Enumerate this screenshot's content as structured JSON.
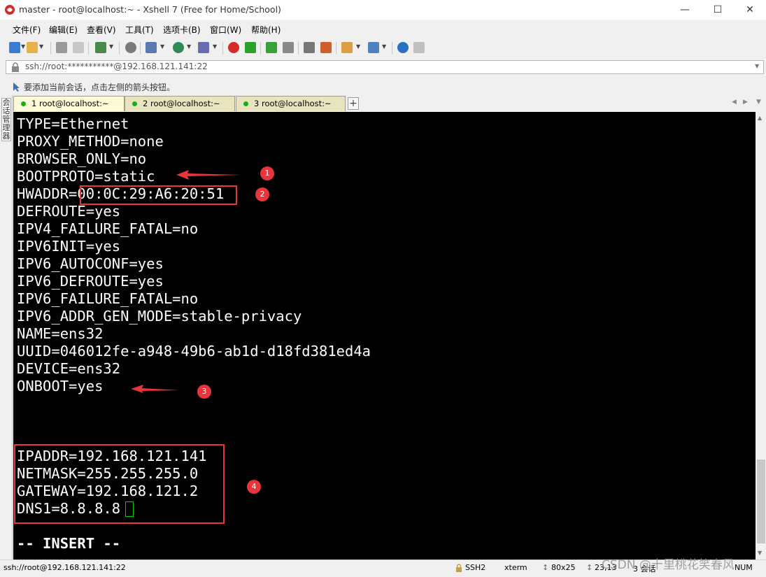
{
  "window": {
    "title": "master - root@localhost:~ - Xshell 7 (Free for Home/School)"
  },
  "menu": [
    "文件(F)",
    "编辑(E)",
    "查看(V)",
    "工具(T)",
    "选项卡(B)",
    "窗口(W)",
    "帮助(H)"
  ],
  "address": "ssh://root:***********@192.168.121.141:22",
  "hint": "要添加当前会话，点击左侧的箭头按钮。",
  "side_panel_label": "会话管理器",
  "tabs": [
    {
      "label": "1 root@localhost:~",
      "active": true
    },
    {
      "label": "2 root@localhost:~",
      "active": false
    },
    {
      "label": "3 root@localhost:~",
      "active": false
    }
  ],
  "terminal_lines": [
    "TYPE=Ethernet",
    "PROXY_METHOD=none",
    "BROWSER_ONLY=no",
    "BOOTPROTO=static",
    "HWADDR=00:0C:29:A6:20:51",
    "DEFROUTE=yes",
    "IPV4_FAILURE_FATAL=no",
    "IPV6INIT=yes",
    "IPV6_AUTOCONF=yes",
    "IPV6_DEFROUTE=yes",
    "IPV6_FAILURE_FATAL=no",
    "IPV6_ADDR_GEN_MODE=stable-privacy",
    "NAME=ens32",
    "UUID=046012fe-a948-49b6-ab1d-d18fd381ed4a",
    "DEVICE=ens32",
    "ONBOOT=yes",
    "",
    "",
    "",
    "IPADDR=192.168.121.141",
    "NETMASK=255.255.255.0",
    "GATEWAY=192.168.121.2",
    "DNS1=8.8.8.8",
    "",
    "-- INSERT --"
  ],
  "annotations": [
    "1",
    "2",
    "3",
    "4"
  ],
  "status": {
    "connection": "ssh://root@192.168.121.141:22",
    "protocol": "SSH2",
    "terminal": "xterm",
    "size": "80x25",
    "position": "23,13",
    "sessions": "3 会话",
    "mode": "NUM"
  },
  "watermark": "CSDN @十里桃花笑春风",
  "colors": {
    "annotation": "#e8343a",
    "terminal_bg": "#000000",
    "terminal_fg": "#ffffff",
    "cursor": "#00d000",
    "active_tab": "#fdfbd7",
    "inactive_tab": "#e8e4c0"
  }
}
